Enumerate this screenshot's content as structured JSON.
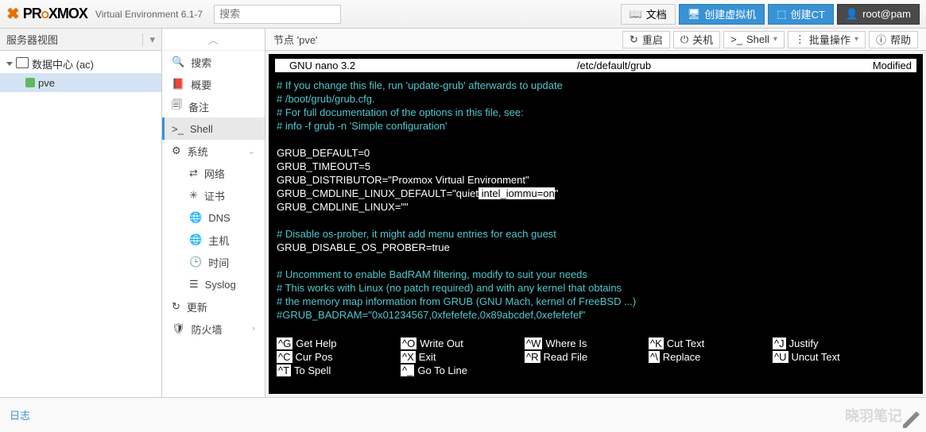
{
  "header": {
    "product": "PROXMOX",
    "subtitle": "Virtual Environment 6.1-7",
    "search_placeholder": "搜索",
    "buttons": {
      "docs": "文档",
      "create_vm": "创建虚拟机",
      "create_ct": "创建CT",
      "user": "root@pam"
    }
  },
  "left": {
    "view_label": "服务器视图",
    "datacenter": "数据中心 (ac)",
    "node": "pve"
  },
  "mid": {
    "items": {
      "search": "搜索",
      "summary": "概要",
      "notes": "备注",
      "shell": "Shell",
      "system": "系统",
      "network": "网络",
      "certs": "证书",
      "dns": "DNS",
      "hosts": "主机",
      "time": "时间",
      "syslog": "Syslog",
      "updates": "更新",
      "firewall": "防火墙"
    }
  },
  "crumb": {
    "label": "节点 'pve'",
    "reboot": "重启",
    "shutdown": "关机",
    "shell": "Shell",
    "bulk": "批量操作",
    "help": "帮助"
  },
  "nano": {
    "left": "GNU nano 3.2",
    "center": "/etc/default/grub",
    "right": "Modified",
    "comment1": "# If you change this file, run 'update-grub' afterwards to update",
    "comment2": "# /boot/grub/grub.cfg.",
    "comment3": "# For full documentation of the options in this file, see:",
    "comment4": "#   info -f grub -n 'Simple configuration'",
    "l_default": "GRUB_DEFAULT=0",
    "l_timeout": "GRUB_TIMEOUT=5",
    "l_distrib": "GRUB_DISTRIBUTOR=\"Proxmox Virtual Environment\"",
    "l_cmd_pre": "GRUB_CMDLINE_LINUX_DEFAULT=\"quiet",
    "l_cmd_hl": " intel_iommu=on",
    "l_cmd_post": "\"",
    "l_cmd_linux": "GRUB_CMDLINE_LINUX=\"\"",
    "c_osprober": "# Disable os-prober, it might add menu entries for each guest",
    "l_osprober": "GRUB_DISABLE_OS_PROBER=true",
    "c_badram1": "# Uncomment to enable BadRAM filtering, modify to suit your needs",
    "c_badram2": "# This works with Linux (no patch required) and with any kernel that obtains",
    "c_badram3": "# the memory map information from GRUB (GNU Mach, kernel of FreeBSD ...)",
    "c_badram4": "#GRUB_BADRAM=\"0x01234567,0xfefefefe,0x89abcdef,0xefefefef\"",
    "keys": {
      "g": "Get Help",
      "x": "Exit",
      "o": "Write Out",
      "r": "Read File",
      "w": "Where Is",
      "rep": "Replace",
      "k": "Cut Text",
      "u": "Uncut Text",
      "j": "Justify",
      "t": "To Spell",
      "c": "Cur Pos",
      "underscore": "Go To Line"
    }
  },
  "bottom": {
    "log": "日志",
    "watermark": "晓羽笔记"
  }
}
